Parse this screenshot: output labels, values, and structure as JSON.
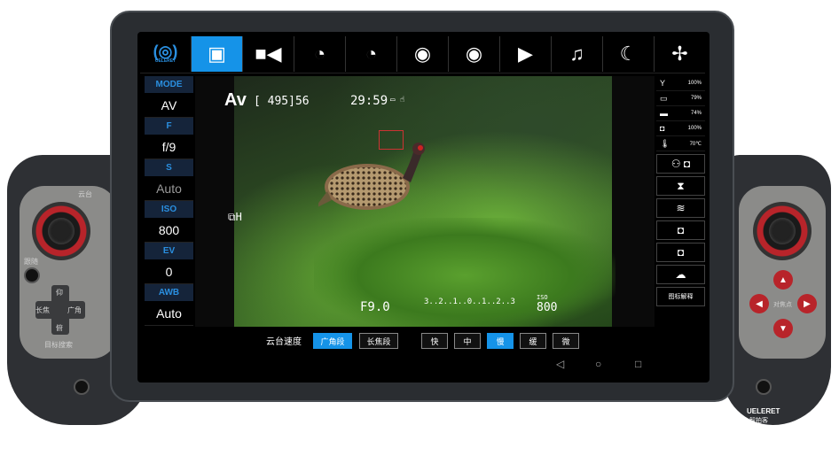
{
  "topbar": {
    "logo": "(◎)",
    "logo_sub": "UELERET",
    "icons": [
      {
        "name": "photo-camera-icon",
        "glyph": "▣",
        "active": true
      },
      {
        "name": "video-camera-icon",
        "glyph": "■◀"
      },
      {
        "name": "timelapse-photo-icon",
        "glyph": "◔"
      },
      {
        "name": "timelapse-video-icon",
        "glyph": "◔"
      },
      {
        "name": "camera-timer-icon",
        "glyph": "◉"
      },
      {
        "name": "camera-interval-icon",
        "glyph": "◉"
      },
      {
        "name": "playback-icon",
        "glyph": "▶"
      },
      {
        "name": "music-icon",
        "glyph": "♫"
      },
      {
        "name": "night-mode-icon",
        "glyph": "☾"
      },
      {
        "name": "fan-icon",
        "glyph": "✢"
      }
    ]
  },
  "settings": [
    {
      "label": "MODE",
      "value": "AV"
    },
    {
      "label": "F",
      "value": "f/9"
    },
    {
      "label": "S",
      "value": "Auto"
    },
    {
      "label": "ISO",
      "value": "800"
    },
    {
      "label": "EV",
      "value": "0"
    },
    {
      "label": "AWB",
      "value": "Auto"
    }
  ],
  "overlay": {
    "mode": "Av",
    "shots": "[ 495]56",
    "timer": "29:59",
    "drive": "⧉H",
    "aperture": "F9.0",
    "exposure_scale": "3..2..1..0..1..2..3",
    "iso_label": "ISO",
    "iso": "800"
  },
  "status": [
    {
      "icon": "signal-icon",
      "glyph": "Y",
      "value": "100%"
    },
    {
      "icon": "battery-icon",
      "glyph": "▭",
      "value": "79%"
    },
    {
      "icon": "device-battery-icon",
      "glyph": "▬",
      "value": "74%"
    },
    {
      "icon": "camera-battery-icon",
      "glyph": "◘",
      "value": "100%"
    },
    {
      "icon": "temperature-icon",
      "glyph": "🌡",
      "value": "70℃"
    }
  ],
  "right_buttons": [
    {
      "name": "gamepad-camera-icon",
      "glyph": "⚇ ◘"
    },
    {
      "name": "hourglass-icon",
      "glyph": "⧗"
    },
    {
      "name": "wifi-icon",
      "glyph": "≋"
    },
    {
      "name": "shutter-icon",
      "glyph": "◘"
    },
    {
      "name": "camera-off-icon",
      "glyph": "◘"
    },
    {
      "name": "upload-icon",
      "glyph": "☁"
    }
  ],
  "help_button": "图标解释",
  "gimbal": {
    "label": "云台速度",
    "wide": "广角段",
    "tele": "长焦段",
    "speeds": [
      "快",
      "中",
      "慢",
      "缓",
      "微"
    ],
    "active_speed": "慢"
  },
  "controller_left": {
    "stick_label": "云台",
    "follow": "跟随",
    "up": "仰",
    "down": "俯",
    "left": "长焦",
    "right": "广角",
    "target": "目标搜索"
  },
  "controller_right": {
    "focus": "对焦点",
    "brand": "UELERET",
    "brand_cn": "智拍客"
  },
  "colors": {
    "accent": "#1593e8",
    "red": "#b8242a"
  }
}
